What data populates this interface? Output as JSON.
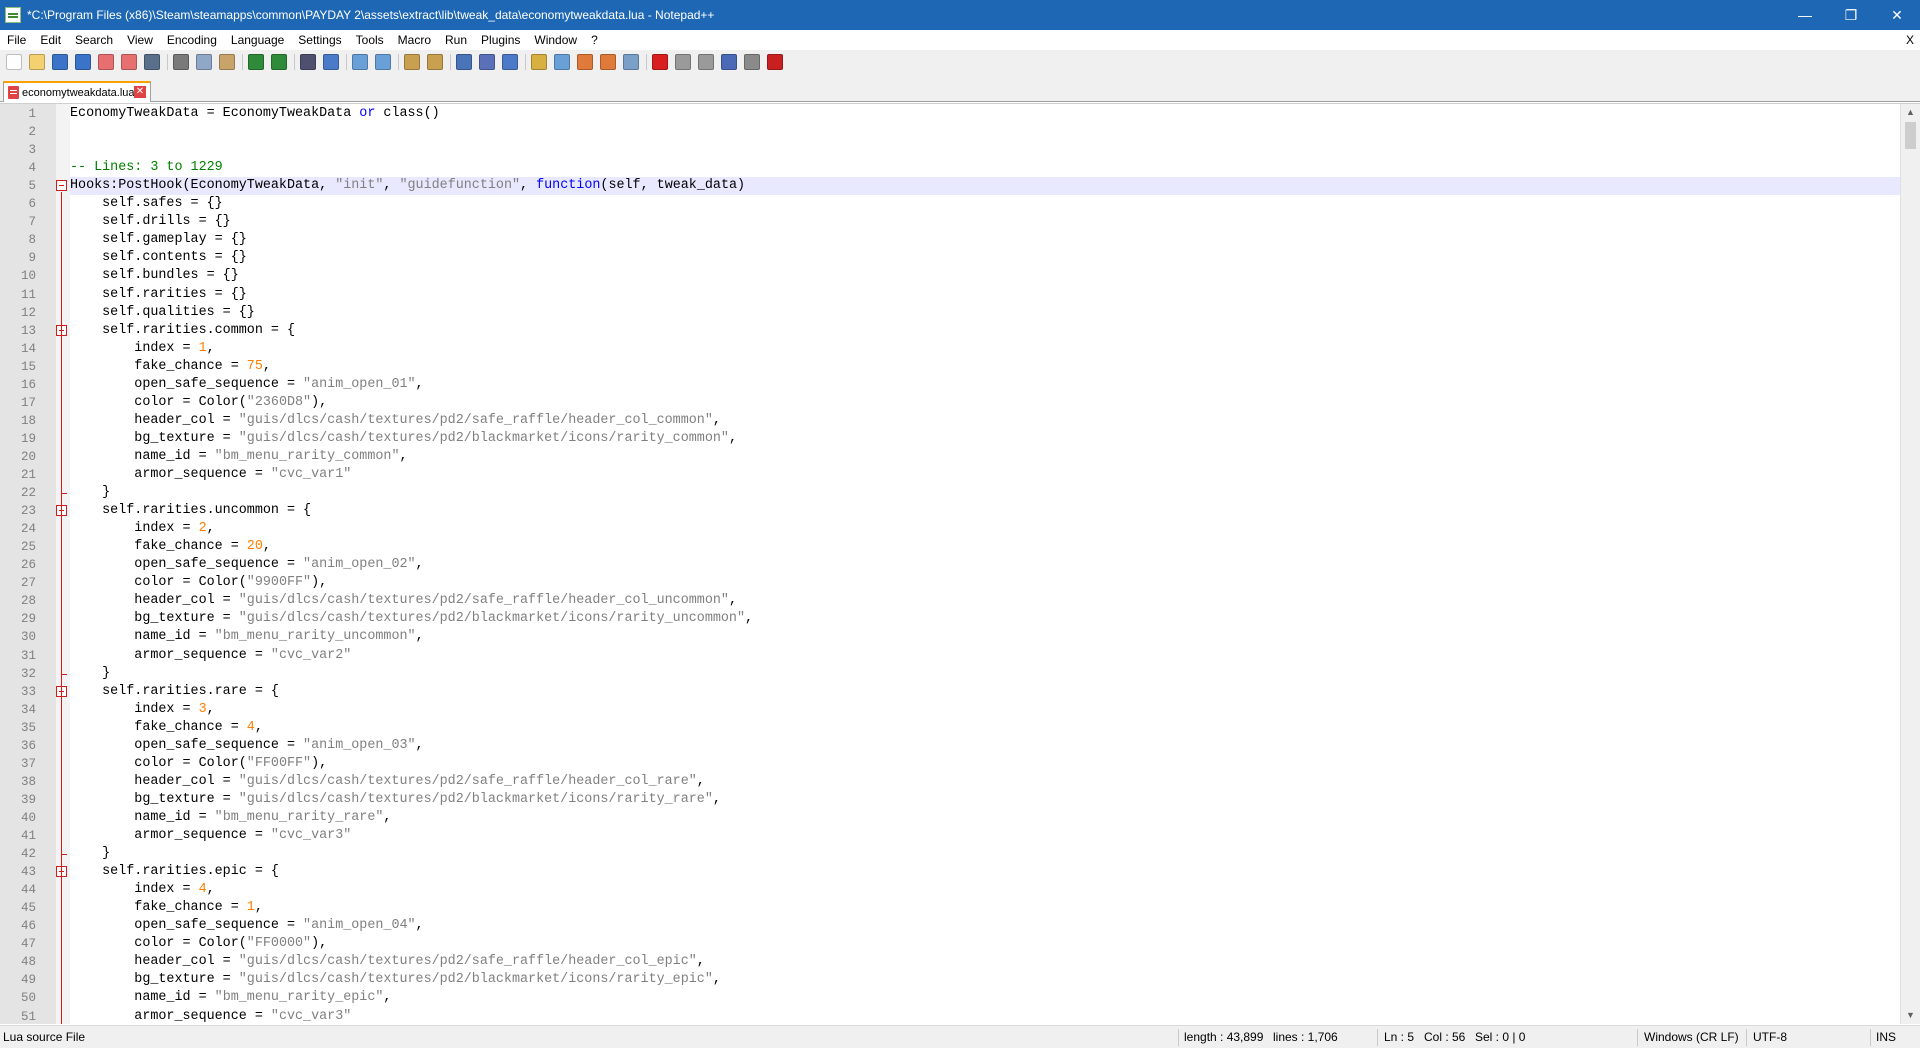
{
  "window": {
    "title": "*C:\\Program Files (x86)\\Steam\\steamapps\\common\\PAYDAY 2\\assets\\extract\\lib\\tweak_data\\economytweakdata.lua - Notepad++",
    "minimize": "—",
    "restore": "❐",
    "close": "✕"
  },
  "menu": {
    "items": [
      "File",
      "Edit",
      "Search",
      "View",
      "Encoding",
      "Language",
      "Settings",
      "Tools",
      "Macro",
      "Run",
      "Plugins",
      "Window",
      "?"
    ],
    "close_label": "X"
  },
  "toolbar": {
    "icons": [
      "new-file-icon",
      "open-file-icon",
      "save-icon",
      "save-all-icon",
      "close-icon",
      "close-all-icon",
      "print-icon",
      "cut-icon",
      "copy-icon",
      "paste-icon",
      "undo-icon",
      "redo-icon",
      "find-icon",
      "replace-icon",
      "zoom-in-icon",
      "zoom-out-icon",
      "sync-vertical-icon",
      "sync-horizontal-icon",
      "word-wrap-icon",
      "show-all-chars-icon",
      "indent-guide-icon",
      "udl-icon",
      "doc-map-icon",
      "function-list-icon",
      "folder-workspace-icon",
      "monitoring-icon",
      "record-macro-icon",
      "stop-macro-icon",
      "play-macro-icon",
      "run-macro-multiple-icon",
      "save-macro-icon",
      "spell-check-icon"
    ]
  },
  "tab": {
    "label": "economytweakdata.lua",
    "close": "✕"
  },
  "editor": {
    "current_line": 5,
    "lines": [
      [
        [
          "EconomyTweakData = EconomyTweakData ",
          ""
        ],
        [
          "or",
          "kw"
        ],
        [
          " class()",
          ""
        ]
      ],
      [],
      [],
      [
        [
          "-- Lines: 3 to 1229",
          "cmt"
        ]
      ],
      [
        [
          "Hooks:PostHook(EconomyTweakData, ",
          ""
        ],
        [
          "\"init\"",
          "str"
        ],
        [
          ", ",
          ""
        ],
        [
          "\"guidefunction\"",
          "str"
        ],
        [
          ", ",
          ""
        ],
        [
          "function",
          "kw"
        ],
        [
          "(self, tweak_data)",
          ""
        ]
      ],
      [
        [
          "    self.safes = {}",
          ""
        ]
      ],
      [
        [
          "    self.drills = {}",
          ""
        ]
      ],
      [
        [
          "    self.gameplay = {}",
          ""
        ]
      ],
      [
        [
          "    self.contents = {}",
          ""
        ]
      ],
      [
        [
          "    self.bundles = {}",
          ""
        ]
      ],
      [
        [
          "    self.rarities = {}",
          ""
        ]
      ],
      [
        [
          "    self.qualities = {}",
          ""
        ]
      ],
      [
        [
          "    self.rarities.common = {",
          ""
        ]
      ],
      [
        [
          "        index = ",
          ""
        ],
        [
          "1",
          "num"
        ],
        [
          ",",
          ""
        ]
      ],
      [
        [
          "        fake_chance = ",
          ""
        ],
        [
          "75",
          "num"
        ],
        [
          ",",
          ""
        ]
      ],
      [
        [
          "        open_safe_sequence = ",
          ""
        ],
        [
          "\"anim_open_01\"",
          "str"
        ],
        [
          ",",
          ""
        ]
      ],
      [
        [
          "        color = Color(",
          ""
        ],
        [
          "\"2360D8\"",
          "str"
        ],
        [
          "),",
          ""
        ]
      ],
      [
        [
          "        header_col = ",
          ""
        ],
        [
          "\"guis/dlcs/cash/textures/pd2/safe_raffle/header_col_common\"",
          "str"
        ],
        [
          ",",
          ""
        ]
      ],
      [
        [
          "        bg_texture = ",
          ""
        ],
        [
          "\"guis/dlcs/cash/textures/pd2/blackmarket/icons/rarity_common\"",
          "str"
        ],
        [
          ",",
          ""
        ]
      ],
      [
        [
          "        name_id = ",
          ""
        ],
        [
          "\"bm_menu_rarity_common\"",
          "str"
        ],
        [
          ",",
          ""
        ]
      ],
      [
        [
          "        armor_sequence = ",
          ""
        ],
        [
          "\"cvc_var1\"",
          "str"
        ]
      ],
      [
        [
          "    }",
          ""
        ]
      ],
      [
        [
          "    self.rarities.uncommon = {",
          ""
        ]
      ],
      [
        [
          "        index = ",
          ""
        ],
        [
          "2",
          "num"
        ],
        [
          ",",
          ""
        ]
      ],
      [
        [
          "        fake_chance = ",
          ""
        ],
        [
          "20",
          "num"
        ],
        [
          ",",
          ""
        ]
      ],
      [
        [
          "        open_safe_sequence = ",
          ""
        ],
        [
          "\"anim_open_02\"",
          "str"
        ],
        [
          ",",
          ""
        ]
      ],
      [
        [
          "        color = Color(",
          ""
        ],
        [
          "\"9900FF\"",
          "str"
        ],
        [
          "),",
          ""
        ]
      ],
      [
        [
          "        header_col = ",
          ""
        ],
        [
          "\"guis/dlcs/cash/textures/pd2/safe_raffle/header_col_uncommon\"",
          "str"
        ],
        [
          ",",
          ""
        ]
      ],
      [
        [
          "        bg_texture = ",
          ""
        ],
        [
          "\"guis/dlcs/cash/textures/pd2/blackmarket/icons/rarity_uncommon\"",
          "str"
        ],
        [
          ",",
          ""
        ]
      ],
      [
        [
          "        name_id = ",
          ""
        ],
        [
          "\"bm_menu_rarity_uncommon\"",
          "str"
        ],
        [
          ",",
          ""
        ]
      ],
      [
        [
          "        armor_sequence = ",
          ""
        ],
        [
          "\"cvc_var2\"",
          "str"
        ]
      ],
      [
        [
          "    }",
          ""
        ]
      ],
      [
        [
          "    self.rarities.rare = {",
          ""
        ]
      ],
      [
        [
          "        index = ",
          ""
        ],
        [
          "3",
          "num"
        ],
        [
          ",",
          ""
        ]
      ],
      [
        [
          "        fake_chance = ",
          ""
        ],
        [
          "4",
          "num"
        ],
        [
          ",",
          ""
        ]
      ],
      [
        [
          "        open_safe_sequence = ",
          ""
        ],
        [
          "\"anim_open_03\"",
          "str"
        ],
        [
          ",",
          ""
        ]
      ],
      [
        [
          "        color = Color(",
          ""
        ],
        [
          "\"FF00FF\"",
          "str"
        ],
        [
          "),",
          ""
        ]
      ],
      [
        [
          "        header_col = ",
          ""
        ],
        [
          "\"guis/dlcs/cash/textures/pd2/safe_raffle/header_col_rare\"",
          "str"
        ],
        [
          ",",
          ""
        ]
      ],
      [
        [
          "        bg_texture = ",
          ""
        ],
        [
          "\"guis/dlcs/cash/textures/pd2/blackmarket/icons/rarity_rare\"",
          "str"
        ],
        [
          ",",
          ""
        ]
      ],
      [
        [
          "        name_id = ",
          ""
        ],
        [
          "\"bm_menu_rarity_rare\"",
          "str"
        ],
        [
          ",",
          ""
        ]
      ],
      [
        [
          "        armor_sequence = ",
          ""
        ],
        [
          "\"cvc_var3\"",
          "str"
        ]
      ],
      [
        [
          "    }",
          ""
        ]
      ],
      [
        [
          "    self.rarities.epic = {",
          ""
        ]
      ],
      [
        [
          "        index = ",
          ""
        ],
        [
          "4",
          "num"
        ],
        [
          ",",
          ""
        ]
      ],
      [
        [
          "        fake_chance = ",
          ""
        ],
        [
          "1",
          "num"
        ],
        [
          ",",
          ""
        ]
      ],
      [
        [
          "        open_safe_sequence = ",
          ""
        ],
        [
          "\"anim_open_04\"",
          "str"
        ],
        [
          ",",
          ""
        ]
      ],
      [
        [
          "        color = Color(",
          ""
        ],
        [
          "\"FF0000\"",
          "str"
        ],
        [
          "),",
          ""
        ]
      ],
      [
        [
          "        header_col = ",
          ""
        ],
        [
          "\"guis/dlcs/cash/textures/pd2/safe_raffle/header_col_epic\"",
          "str"
        ],
        [
          ",",
          ""
        ]
      ],
      [
        [
          "        bg_texture = ",
          ""
        ],
        [
          "\"guis/dlcs/cash/textures/pd2/blackmarket/icons/rarity_epic\"",
          "str"
        ],
        [
          ",",
          ""
        ]
      ],
      [
        [
          "        name_id = ",
          ""
        ],
        [
          "\"bm_menu_rarity_epic\"",
          "str"
        ],
        [
          ",",
          ""
        ]
      ],
      [
        [
          "        armor_sequence = ",
          ""
        ],
        [
          "\"cvc_var3\"",
          "str"
        ]
      ]
    ]
  },
  "status": {
    "file_type": "Lua source File",
    "length": "length : 43,899",
    "lines": "lines : 1,706",
    "ln": "Ln : 5",
    "col": "Col : 56",
    "sel": "Sel : 0 | 0",
    "eol": "Windows (CR LF)",
    "encoding": "UTF-8",
    "mode": "INS"
  },
  "colors": {
    "titlebar": "#1e67b4",
    "keyword": "#0000ff",
    "string": "#808080",
    "number": "#ff8000",
    "comment": "#008000",
    "fold_marker": "#d31b1b",
    "current_line": "#e8e8ff"
  }
}
